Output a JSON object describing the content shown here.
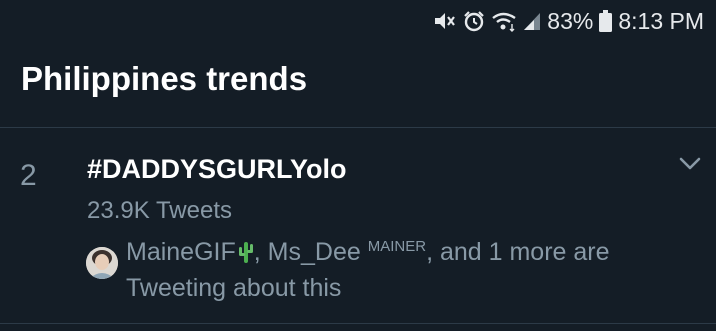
{
  "status_bar": {
    "icons": [
      "mute-icon",
      "alarm-icon",
      "wifi-icon",
      "signal-icon",
      "battery-icon"
    ],
    "battery_percent": "83%",
    "time": "8:13 PM"
  },
  "header": {
    "title": "Philippines trends"
  },
  "trend": {
    "rank": "2",
    "name": "#DADDYSGURLYolo",
    "tweet_count": "23.9K Tweets",
    "context": {
      "user1": "MaineGIF",
      "user1_emoji": "cactus",
      "separator": ", ",
      "user2": "Ms_Dee",
      "user2_sup": "MAINER",
      "tail": ", and 1 more are Tweeting about this"
    }
  },
  "colors": {
    "background": "#141d26",
    "primary_text": "#ffffff",
    "secondary_text": "#8899a6",
    "divider": "#2c3a47"
  }
}
